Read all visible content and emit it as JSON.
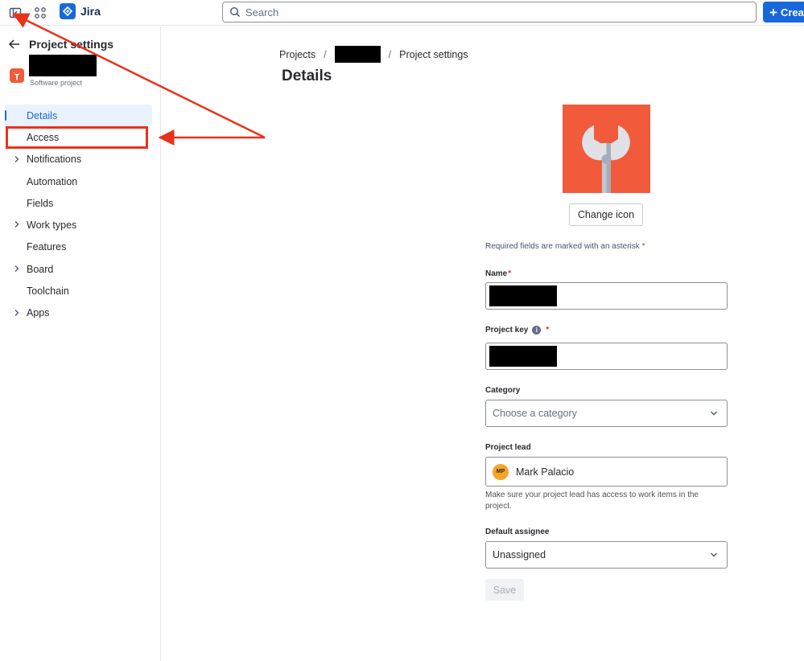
{
  "topbar": {
    "app_name": "Jira",
    "search_placeholder": "Search",
    "create_label": "Create",
    "icons": [
      "sidebar-toggle-icon",
      "app-switcher-icon",
      "jira-logo-icon",
      "search-icon",
      "plus-icon"
    ]
  },
  "sidebar": {
    "back_title": "Project settings",
    "project_type": "Software project",
    "items": [
      {
        "label": "Details",
        "active": true,
        "expandable": false
      },
      {
        "label": "Access",
        "active": false,
        "expandable": false
      },
      {
        "label": "Notifications",
        "active": false,
        "expandable": true
      },
      {
        "label": "Automation",
        "active": false,
        "expandable": false
      },
      {
        "label": "Fields",
        "active": false,
        "expandable": false
      },
      {
        "label": "Work types",
        "active": false,
        "expandable": true
      },
      {
        "label": "Features",
        "active": false,
        "expandable": false
      },
      {
        "label": "Board",
        "active": false,
        "expandable": true
      },
      {
        "label": "Toolchain",
        "active": false,
        "expandable": false
      },
      {
        "label": "Apps",
        "active": false,
        "expandable": true
      }
    ]
  },
  "main": {
    "breadcrumb": {
      "root": "Projects",
      "separator": "/",
      "current": "Project settings"
    },
    "title": "Details",
    "change_icon_label": "Change icon",
    "required_note": "Required fields are marked with an asterisk",
    "asterisk": "*",
    "fields": {
      "name_label": "Name",
      "project_key_label": "Project key",
      "category_label": "Category",
      "category_placeholder": "Choose a category",
      "project_lead_label": "Project lead",
      "project_lead_initials": "MP",
      "project_lead_value": "Mark Palacio",
      "project_lead_helper": "Make sure your project lead has access to work items in the project.",
      "default_assignee_label": "Default assignee",
      "default_assignee_value": "Unassigned"
    },
    "save_label": "Save"
  },
  "colors": {
    "brand": "#1868db",
    "project_icon": "#f15b3b",
    "annotation": "#e8321c",
    "required": "#c9372c"
  }
}
